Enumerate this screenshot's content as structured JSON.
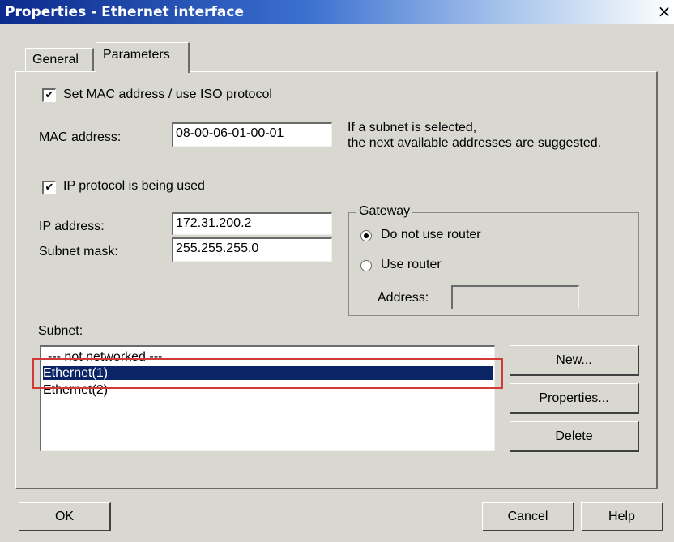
{
  "window": {
    "title": "Properties - Ethernet interface",
    "close_symbol": "×"
  },
  "tabs": [
    {
      "label": "General",
      "active": false
    },
    {
      "label": "Parameters",
      "active": true
    }
  ],
  "mac_section": {
    "checkbox_label": "Set MAC address / use ISO protocol",
    "checked": true,
    "mac_label": "MAC address:",
    "mac_value": "08-00-06-01-00-01",
    "hint_line1": "If a subnet is selected,",
    "hint_line2": "the next available addresses are suggested."
  },
  "ip_section": {
    "checkbox_label": "IP protocol is being used",
    "checked": true,
    "ip_label": "IP address:",
    "ip_value": "172.31.200.2",
    "subnet_label": "Subnet mask:",
    "subnet_value": "255.255.255.0"
  },
  "gateway": {
    "group_label": "Gateway",
    "options": [
      {
        "label": "Do not use router",
        "selected": true
      },
      {
        "label": "Use router",
        "selected": false
      }
    ],
    "address_label": "Address:",
    "address_value": ""
  },
  "subnet": {
    "label": "Subnet:",
    "items": [
      {
        "label": "--- not networked ---",
        "selected": false
      },
      {
        "label": "Ethernet(1)",
        "selected": true
      },
      {
        "label": "Ethernet(2)",
        "selected": false
      }
    ]
  },
  "side_buttons": {
    "new": "New...",
    "properties": "Properties...",
    "delete": "Delete"
  },
  "footer": {
    "ok": "OK",
    "cancel": "Cancel",
    "help": "Help"
  },
  "colors": {
    "title_start": "#0b2a8c",
    "selection": "#0a2466",
    "annotation": "#d23a3a",
    "dialog_bg": "#d8d8d0"
  }
}
